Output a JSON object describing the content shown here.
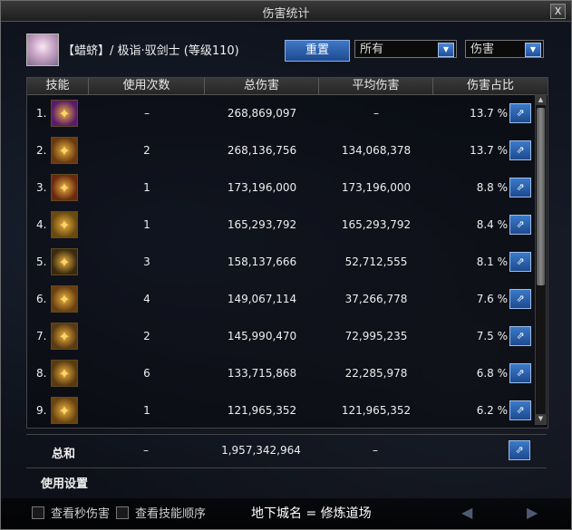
{
  "window": {
    "title": "伤害统计",
    "close_label": "X"
  },
  "character": {
    "info": "【蜡蛴】/ 极诣·驭剑士 (等级110)"
  },
  "controls": {
    "reset_label": "重置",
    "filter_value": "所有",
    "type_value": "伤害"
  },
  "table": {
    "headers": [
      "技能",
      "使用次数",
      "总伤害",
      "平均伤害",
      "伤害占比"
    ],
    "rows": [
      {
        "rank": "1.",
        "uses": "–",
        "total": "268,869,097",
        "avg": "–",
        "share": "13.7 %",
        "icon": "burst-skill-icon",
        "icon_color": "#5a1c6a"
      },
      {
        "rank": "2.",
        "uses": "2",
        "total": "268,136,756",
        "avg": "134,068,378",
        "share": "13.7 %",
        "icon": "wave-slash-icon",
        "icon_color": "#6a3a10"
      },
      {
        "rank": "3.",
        "uses": "1",
        "total": "173,196,000",
        "avg": "173,196,000",
        "share": "8.8 %",
        "icon": "flame-slash-icon",
        "icon_color": "#6a2a10"
      },
      {
        "rank": "4.",
        "uses": "1",
        "total": "165,293,792",
        "avg": "165,293,792",
        "share": "8.4 %",
        "icon": "sword-rain-icon",
        "icon_color": "#6a4a10"
      },
      {
        "rank": "5.",
        "uses": "3",
        "total": "158,137,666",
        "avg": "52,712,555",
        "share": "8.1 %",
        "icon": "crescent-icon",
        "icon_color": "#3a2a10"
      },
      {
        "rank": "6.",
        "uses": "4",
        "total": "149,067,114",
        "avg": "37,266,778",
        "share": "7.6 %",
        "icon": "quick-slash-icon",
        "icon_color": "#6a4010"
      },
      {
        "rank": "7.",
        "uses": "2",
        "total": "145,990,470",
        "avg": "72,995,235",
        "share": "7.5 %",
        "icon": "spirit-blade-icon",
        "icon_color": "#5a3a12"
      },
      {
        "rank": "8.",
        "uses": "6",
        "total": "133,715,868",
        "avg": "22,285,978",
        "share": "6.8 %",
        "icon": "dash-slash-icon",
        "icon_color": "#5a3a10"
      },
      {
        "rank": "9.",
        "uses": "1",
        "total": "121,965,352",
        "avg": "121,965,352",
        "share": "6.2 %",
        "icon": "rising-blade-icon",
        "icon_color": "#6a4410"
      }
    ]
  },
  "summary": {
    "label": "总和",
    "uses": "–",
    "total": "1,957,342,964",
    "avg": "–"
  },
  "settings": {
    "label": "使用设置"
  },
  "footer": {
    "checkbox1_label": "查看秒伤害",
    "checkbox2_label": "查看技能顺序",
    "dungeon": "地下城名 = 修炼道场"
  }
}
